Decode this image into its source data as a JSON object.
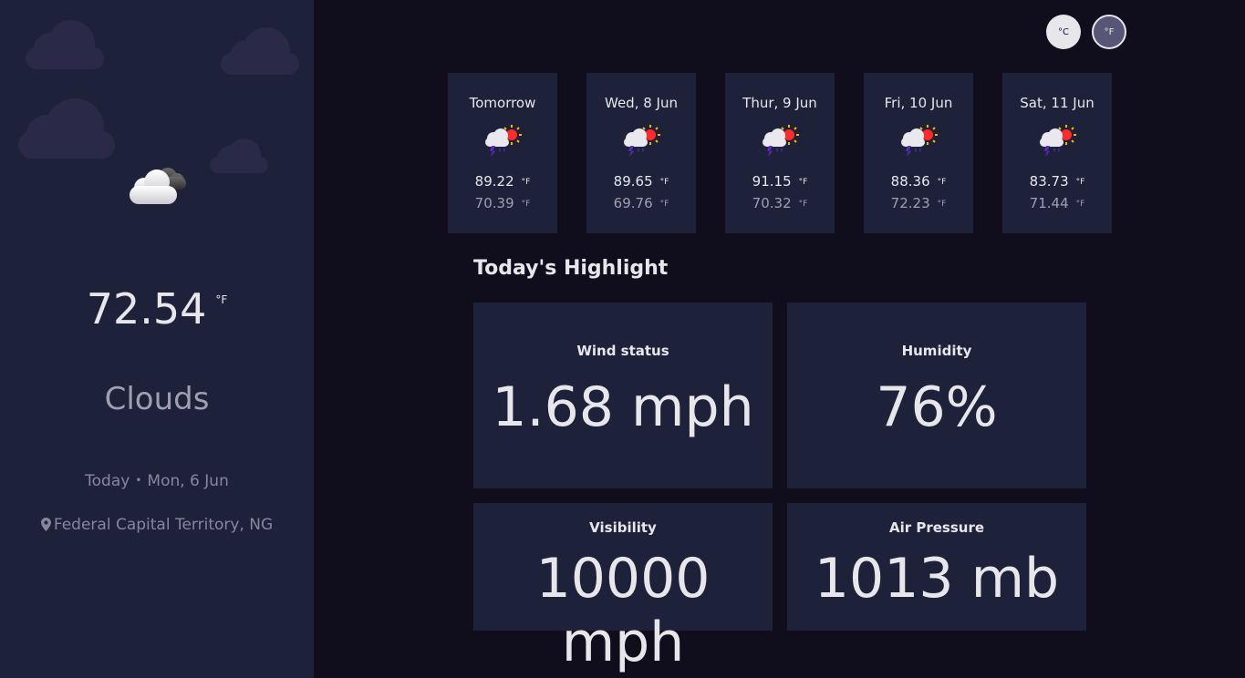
{
  "sidebar": {
    "icon": "cloud-icon",
    "temperature": "72.54",
    "temperature_unit": "°F",
    "condition": "Clouds",
    "date_today": "Today",
    "date_separator": "•",
    "date_value": "Mon, 6 Jun",
    "location_icon": "map-pin-icon",
    "location": "Federal Capital Territory, NG"
  },
  "units": {
    "celsius_label": "°C",
    "fahrenheit_label": "°F",
    "selected": "fahrenheit"
  },
  "forecast": [
    {
      "day": "Tomorrow",
      "icon": "thunderstorm-sun-icon",
      "max": "89.22",
      "min": "70.39",
      "unit": "°F"
    },
    {
      "day": "Wed, 8 Jun",
      "icon": "thunderstorm-sun-icon",
      "max": "89.65",
      "min": "69.76",
      "unit": "°F"
    },
    {
      "day": "Thur, 9 Jun",
      "icon": "thunderstorm-sun-icon",
      "max": "91.15",
      "min": "70.32",
      "unit": "°F"
    },
    {
      "day": "Fri, 10 Jun",
      "icon": "thunderstorm-sun-icon",
      "max": "88.36",
      "min": "72.23",
      "unit": "°F"
    },
    {
      "day": "Sat, 11 Jun",
      "icon": "thunderstorm-sun-icon",
      "max": "83.73",
      "min": "71.44",
      "unit": "°F"
    }
  ],
  "highlights": {
    "title": "Today's Highlight",
    "wind": {
      "label": "Wind status",
      "value": "1.68 mph"
    },
    "humidity": {
      "label": "Humidity",
      "value": "76%"
    },
    "visibility": {
      "label": "Visibility",
      "value": "10000 mph"
    },
    "pressure": {
      "label": "Air Pressure",
      "value": "1013 mb"
    }
  },
  "colors": {
    "background": "#100e1d",
    "panel": "#1e213a",
    "text": "#e7e7eb",
    "muted": "#a09fb1"
  }
}
